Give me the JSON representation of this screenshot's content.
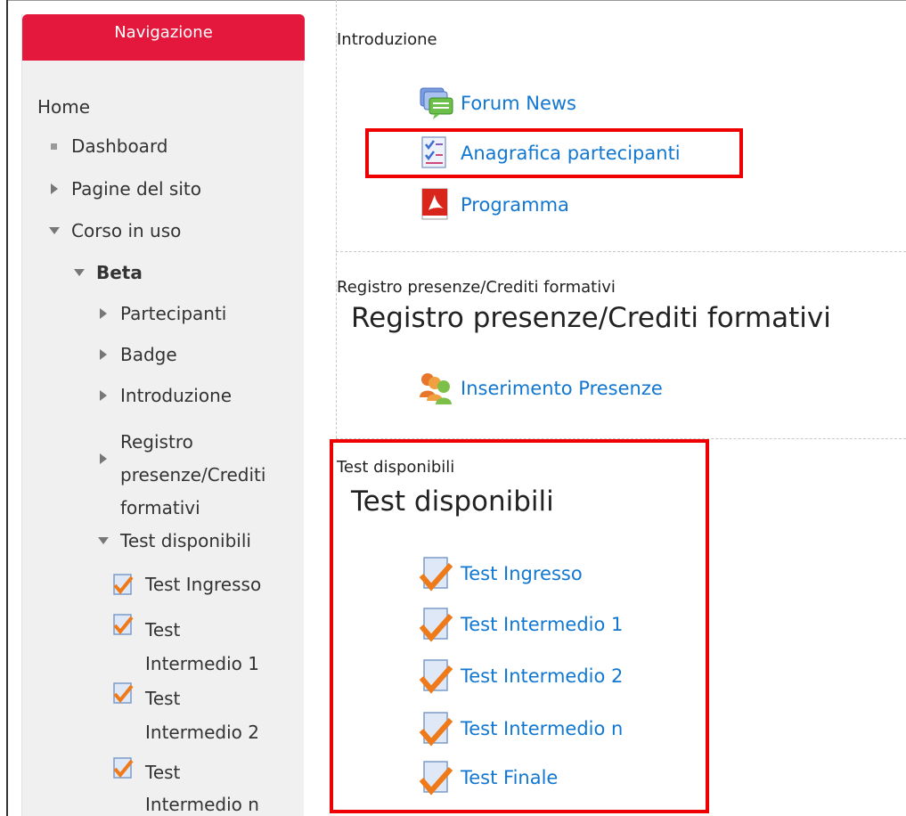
{
  "navigation": {
    "header": "Navigazione",
    "home": "Home",
    "dashboard": "Dashboard",
    "site_pages": "Pagine del sito",
    "current_course": "Corso in uso",
    "course_name": "Beta",
    "participants": "Partecipanti",
    "badge": "Badge",
    "introduction": "Introduzione",
    "registro_line1": "Registro",
    "registro_line2": "presenze/Crediti",
    "registro_line3": "formativi",
    "tests_section": "Test disponibili",
    "test_ingresso": "Test Ingresso",
    "test_int1_line1": "Test",
    "test_int1_line2": "Intermedio 1",
    "test_int2_line1": "Test",
    "test_int2_line2": "Intermedio 2",
    "test_intn_line1": "Test",
    "test_intn_line2": "Intermedio n"
  },
  "main": {
    "section_intro": {
      "title": "Introduzione",
      "activities": [
        "Forum News",
        "Anagrafica partecipanti",
        "Programma"
      ]
    },
    "section_registro": {
      "small_title": "Registro presenze/Crediti formativi",
      "big_title": "Registro presenze/Crediti formativi",
      "activities": [
        "Inserimento Presenze"
      ]
    },
    "section_tests": {
      "small_title": "Test disponibili",
      "big_title": "Test disponibili",
      "activities": [
        "Test Ingresso",
        "Test Intermedio 1",
        "Test Intermedio 2",
        "Test Intermedio n",
        "Test Finale"
      ]
    }
  },
  "colors": {
    "nav_header": "#e4183c",
    "link": "#1177d1",
    "highlight_box": "#ef0000"
  }
}
